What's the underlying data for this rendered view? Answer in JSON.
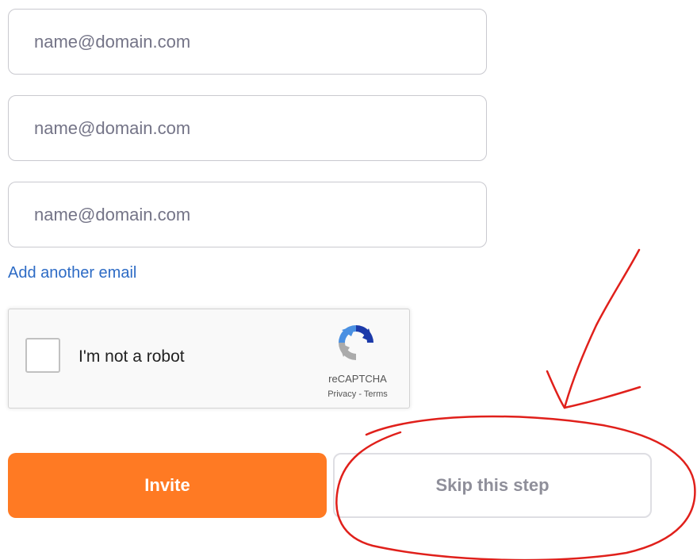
{
  "emails": [
    {
      "placeholder": "name@domain.com",
      "value": ""
    },
    {
      "placeholder": "name@domain.com",
      "value": ""
    },
    {
      "placeholder": "name@domain.com",
      "value": ""
    }
  ],
  "add_email_label": "Add another email",
  "recaptcha": {
    "label": "I'm not a robot",
    "brand": "reCAPTCHA",
    "privacy": "Privacy",
    "separator": " - ",
    "terms": "Terms",
    "checked": false
  },
  "buttons": {
    "invite_label": "Invite",
    "skip_label": "Skip this step"
  },
  "colors": {
    "accent": "#ff7a23",
    "link": "#2d6bc5",
    "annotation": "#e0201b"
  },
  "icons": {
    "recaptcha_logo": "recaptcha-logo-icon",
    "annotation_arrow": "hand-drawn-arrow",
    "annotation_circle": "hand-drawn-circle"
  }
}
